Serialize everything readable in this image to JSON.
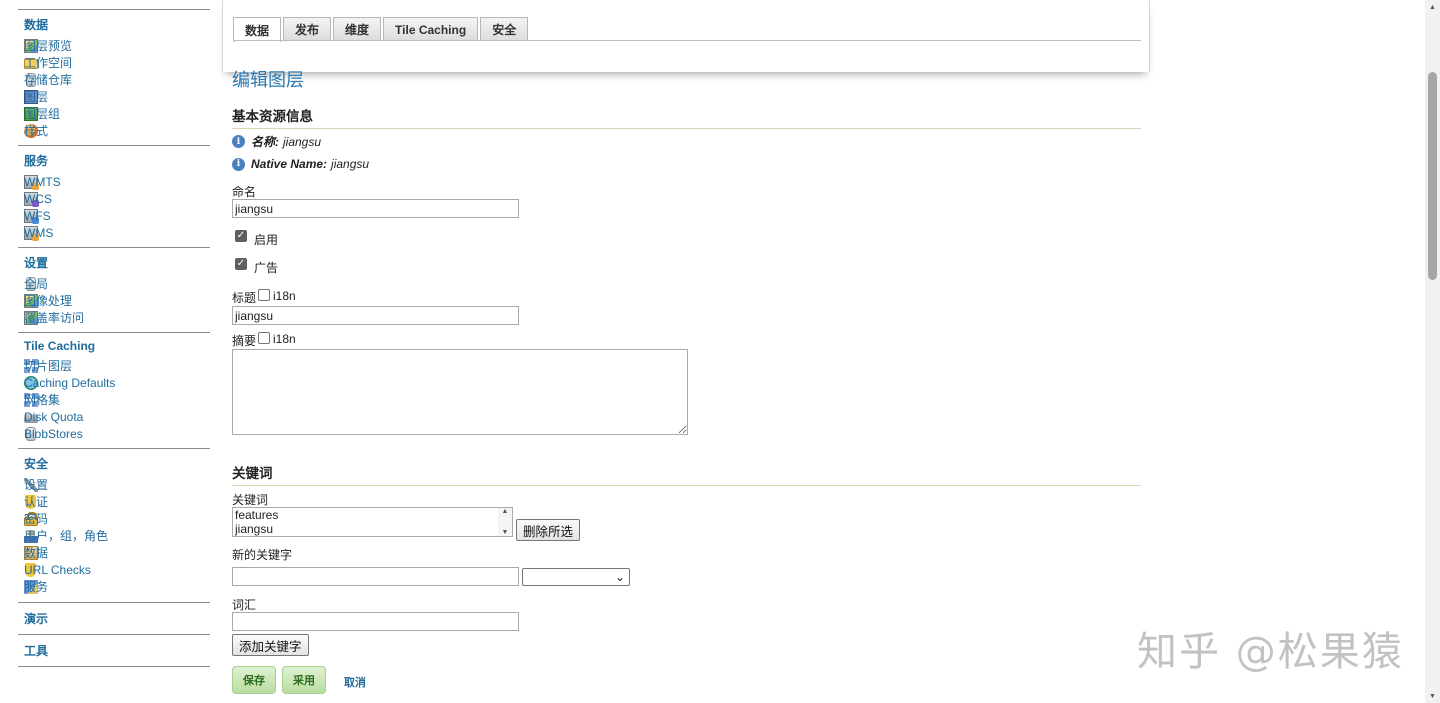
{
  "sidebar": {
    "data_section": {
      "heading": "数据",
      "items": [
        {
          "label": "图层预览",
          "icon": "layer-preview-icon"
        },
        {
          "label": "工作空间",
          "icon": "folder-icon"
        },
        {
          "label": "存储仓库",
          "icon": "datastore-icon"
        },
        {
          "label": "图层",
          "icon": "layer-icon"
        },
        {
          "label": "图层组",
          "icon": "layer-group-icon"
        },
        {
          "label": "样式",
          "icon": "style-palette-icon"
        }
      ]
    },
    "services_section": {
      "heading": "服务",
      "items": [
        {
          "label": "WMTS",
          "icon": "wmts-service-icon"
        },
        {
          "label": "WCS",
          "icon": "wcs-service-icon"
        },
        {
          "label": "WFS",
          "icon": "wfs-service-icon"
        },
        {
          "label": "WMS",
          "icon": "wms-service-icon"
        }
      ]
    },
    "settings_section": {
      "heading": "设置",
      "items": [
        {
          "label": "全局",
          "icon": "server-icon"
        },
        {
          "label": "图像处理",
          "icon": "image-processing-icon"
        },
        {
          "label": "覆盖率访问",
          "icon": "coverage-access-icon"
        }
      ]
    },
    "tile_section": {
      "heading": "Tile Caching",
      "items": [
        {
          "label": "切片图层",
          "icon": "tile-grid-icon"
        },
        {
          "label": "Caching Defaults",
          "icon": "globe-icon"
        },
        {
          "label": "网格集",
          "icon": "gridset-icon"
        },
        {
          "label": "Disk Quota",
          "icon": "disk-icon"
        },
        {
          "label": "BlobStores",
          "icon": "blobstore-icon"
        }
      ]
    },
    "security_section": {
      "heading": "安全",
      "items": [
        {
          "label": "设置",
          "icon": "wrench-icon"
        },
        {
          "label": "认证",
          "icon": "shield-icon"
        },
        {
          "label": "密码",
          "icon": "lock-icon"
        },
        {
          "label": "用户，组，角色",
          "icon": "users-icon"
        },
        {
          "label": "数据",
          "icon": "data-security-icon"
        },
        {
          "label": "URL Checks",
          "icon": "url-shield-icon"
        },
        {
          "label": "服务",
          "icon": "service-security-icon"
        }
      ]
    },
    "demo_heading": "演示",
    "tools_heading": "工具"
  },
  "tabs": [
    "数据",
    "发布",
    "维度",
    "Tile Caching",
    "安全"
  ],
  "active_tab": 0,
  "page_title": "编辑图层",
  "basic_info": {
    "heading": "基本资源信息",
    "name_key": "名称:",
    "name_value": "jiangsu",
    "native_key": "Native Name:",
    "native_value": "jiangsu",
    "name_label": "命名",
    "name_input": "jiangsu",
    "enabled_label": "启用",
    "enabled": true,
    "advertised_label": "广告",
    "advertised": true,
    "title_label": "标题",
    "i18n_label": "i18n",
    "title_input": "jiangsu",
    "abstract_label": "摘要",
    "abstract_input": ""
  },
  "keywords": {
    "heading": "关键词",
    "list_label": "关键词",
    "list": [
      "features",
      "jiangsu"
    ],
    "remove_button": "删除所选",
    "new_keyword_label": "新的关键字",
    "new_keyword_input": "",
    "language_selected": "",
    "vocabulary_label": "词汇",
    "vocabulary_input": "",
    "add_button": "添加关键字"
  },
  "actions": {
    "save": "保存",
    "apply": "采用",
    "cancel": "取消"
  },
  "watermark": "知乎 @松果猿",
  "colors": {
    "link": "#1f6c9c",
    "title": "#2a7ab3",
    "green_button": "#b9dea0"
  }
}
